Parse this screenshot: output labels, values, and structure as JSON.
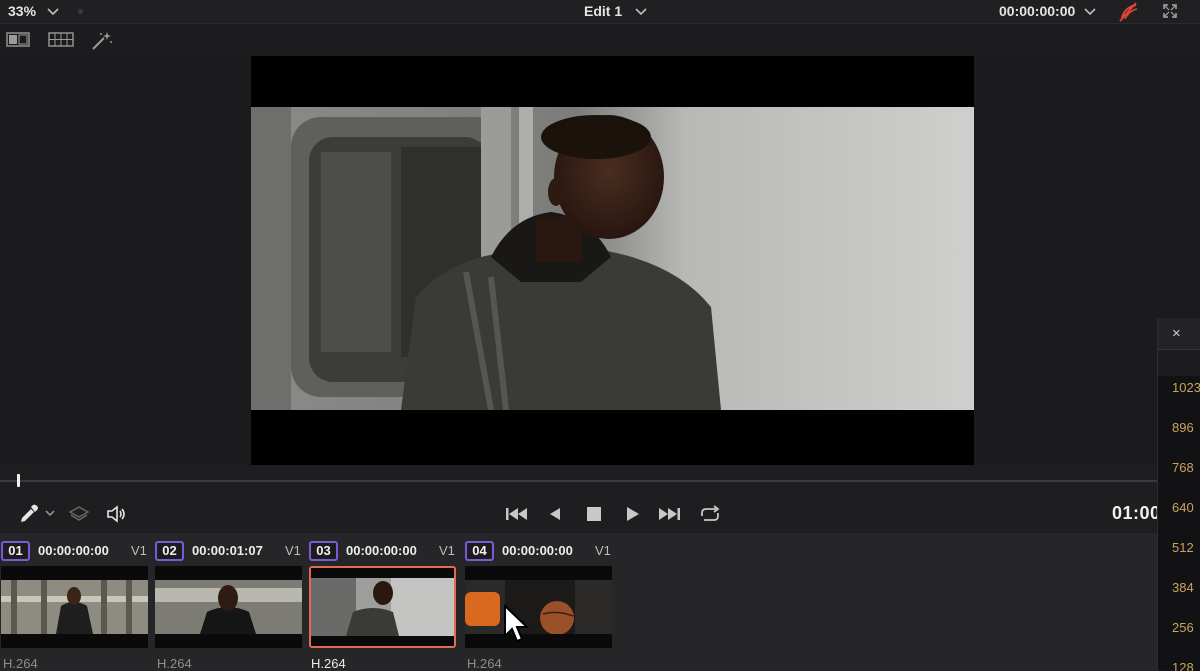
{
  "topbar": {
    "zoom": "33%",
    "timeline_name": "Edit 1",
    "timecode": "00:00:00:00"
  },
  "transport": {
    "timecode": "01:00"
  },
  "clips": [
    {
      "index": "01",
      "timecode": "00:00:00:00",
      "track": "V1",
      "codec": "H.264",
      "badge_color": "#7b5ad6",
      "selected": false
    },
    {
      "index": "02",
      "timecode": "00:00:01:07",
      "track": "V1",
      "codec": "H.264",
      "badge_color": "#7b5ad6",
      "selected": false
    },
    {
      "index": "03",
      "timecode": "00:00:00:00",
      "track": "V1",
      "codec": "H.264",
      "badge_color": "#7b5ad6",
      "selected": true
    },
    {
      "index": "04",
      "timecode": "00:00:00:00",
      "track": "V1",
      "codec": "H.264",
      "badge_color": "#7b5ad6",
      "selected": false
    }
  ],
  "scopes_panel": {
    "close": "×",
    "levels": [
      "1023",
      "896",
      "768",
      "640",
      "512",
      "384",
      "256",
      "128"
    ]
  },
  "colors": {
    "accent_selected": "#e46a55",
    "scope_label": "#c9a35a",
    "bypass_red": "#e0463a"
  }
}
